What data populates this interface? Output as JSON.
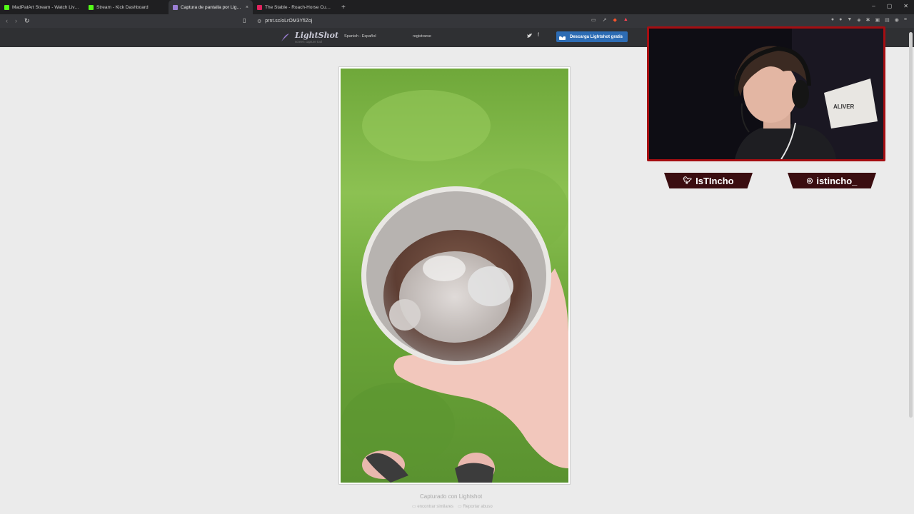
{
  "browser": {
    "tabs": [
      {
        "title": "MadPatArt Stream - Watch Live o",
        "favicon_color": "#53fc18",
        "active": false
      },
      {
        "title": "Stream - Kick Dashboard",
        "favicon_color": "#53fc18",
        "active": false
      },
      {
        "title": "Captura de pantalla por Lightsh",
        "favicon_color": "#9b7fd4",
        "active": true
      },
      {
        "title": "The Stable - Roach-Horse Customiza",
        "favicon_color": "#e0245e",
        "active": false
      }
    ],
    "tab_close": "×",
    "new_tab": "+",
    "address": "prnt.sc/oLrOM3YfiZoj",
    "window_controls": [
      "–",
      "▢",
      "✕"
    ]
  },
  "lightshot": {
    "logo": "LightShot",
    "logo_tagline": "screen capture tool",
    "language": "Spanish - Español",
    "register": "registrarse",
    "download_button": "Descarga Lightshot gratis",
    "caption": "Capturado con Lightshot",
    "link_similar": "encontrar similares",
    "link_report": "Reportar abuso"
  },
  "stream": {
    "twitter_handle": "IsTIncho",
    "instagram_handle": "istincho_",
    "chair_text": "ALIVER"
  },
  "colors": {
    "brand_blue": "#2d6cb4",
    "cam_frame": "#a50e12",
    "badge_bg": "#3a0d10",
    "kick_green": "#53fc18"
  }
}
